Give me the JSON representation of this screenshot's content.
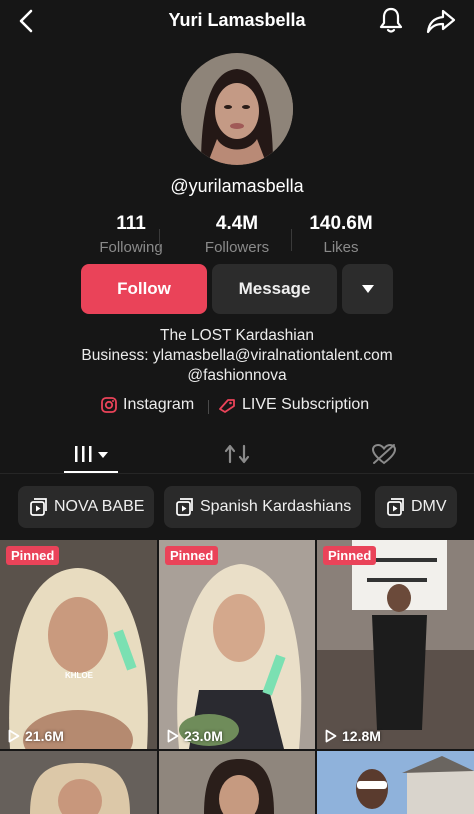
{
  "header": {
    "title": "Yuri Lamasbella",
    "back_icon": "chevron-left-icon",
    "bell_icon": "bell-icon",
    "share_icon": "share-arrow-icon"
  },
  "profile": {
    "handle": "@yurilamasbella"
  },
  "stats": [
    {
      "value": "111",
      "label": "Following"
    },
    {
      "value": "4.4M",
      "label": "Followers"
    },
    {
      "value": "140.6M",
      "label": "Likes"
    }
  ],
  "actions": {
    "follow_label": "Follow",
    "message_label": "Message",
    "more_icon": "caret-down-icon"
  },
  "bio": {
    "line1": "The LOST Kardashian",
    "line2": "Business: ylamasbella@viralnationtalent.com",
    "line3": "@fashionnova"
  },
  "links": {
    "instagram": "Instagram",
    "live": "LIVE Subscription"
  },
  "tabs": {
    "videos_icon": "videos-grid-icon",
    "reposts_icon": "repost-icon",
    "liked_icon": "hidden-heart-icon"
  },
  "playlists": [
    {
      "label": "NOVA BABE"
    },
    {
      "label": "Spanish Kardashians"
    },
    {
      "label": "DMV"
    }
  ],
  "videos": [
    {
      "pinned": "Pinned",
      "views": "21.6M",
      "overlay": "KHLOE"
    },
    {
      "pinned": "Pinned",
      "views": "23.0M"
    },
    {
      "pinned": "Pinned",
      "views": "12.8M"
    },
    {},
    {},
    {}
  ],
  "colors": {
    "accent": "#ea4359",
    "background": "#161616",
    "button_dark": "#2c2c2c"
  }
}
